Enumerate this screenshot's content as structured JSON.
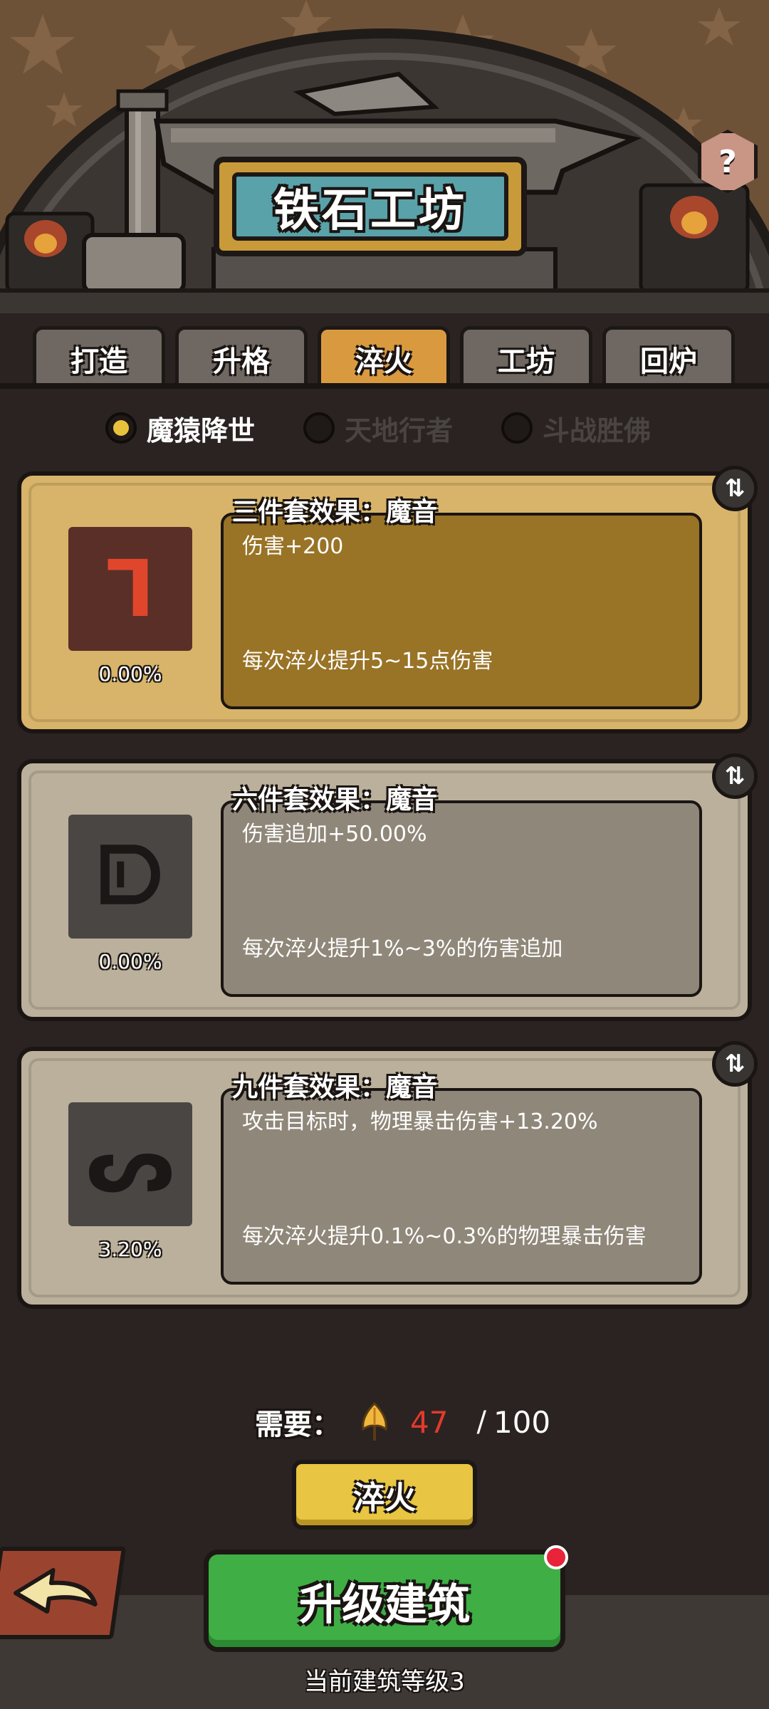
{
  "header": {
    "title": "铁石工坊",
    "help_label": "?"
  },
  "tabs": [
    {
      "label": "打造",
      "active": false
    },
    {
      "label": "升格",
      "active": false
    },
    {
      "label": "淬火",
      "active": true
    },
    {
      "label": "工坊",
      "active": false
    },
    {
      "label": "回炉",
      "active": false
    }
  ],
  "set_selector": [
    {
      "label": "魔猿降世",
      "selected": true
    },
    {
      "label": "天地行者",
      "selected": false
    },
    {
      "label": "斗战胜佛",
      "selected": false
    }
  ],
  "effects": [
    {
      "title": "三件套效果：魔音",
      "main": "伤害+200",
      "growth": "每次淬火提升5~15点伤害",
      "percent": "0.00%",
      "icon": "rune-red-icon",
      "glyph": "ᒣ",
      "active": true,
      "swap_label": "⇅"
    },
    {
      "title": "六件套效果：魔音",
      "main": "伤害追加+50.00%",
      "growth": "每次淬火提升1%~3%的伤害追加",
      "percent": "0.00%",
      "icon": "rune-dark-icon",
      "glyph": "ᗟ",
      "active": false,
      "swap_label": "⇅"
    },
    {
      "title": "九件套效果：魔音",
      "main": "攻击目标时，物理暴击伤害+13.20%",
      "growth": "每次淬火提升0.1%~0.3%的物理暴击伤害",
      "percent": "3.20%",
      "icon": "rune-dark-icon",
      "glyph": "ᔕ",
      "active": false,
      "swap_label": "⇅"
    }
  ],
  "cost": {
    "label": "需要：",
    "material_icon": "golden-leaf-icon",
    "have": "47",
    "separator": "/",
    "need": "100"
  },
  "quench_button": "淬火",
  "upgrade_button": "升级建筑",
  "building_level": "当前建筑等级3",
  "colors": {
    "background": "#2a2321",
    "active_tab": "#d99a3f",
    "inactive_tab": "#6f6862",
    "gold_card": "#d8b46a",
    "grey_card": "#bbb09b",
    "cost_have": "#e33a2c",
    "upgrade_green": "#3fae45",
    "quench_yellow": "#e8c542"
  }
}
